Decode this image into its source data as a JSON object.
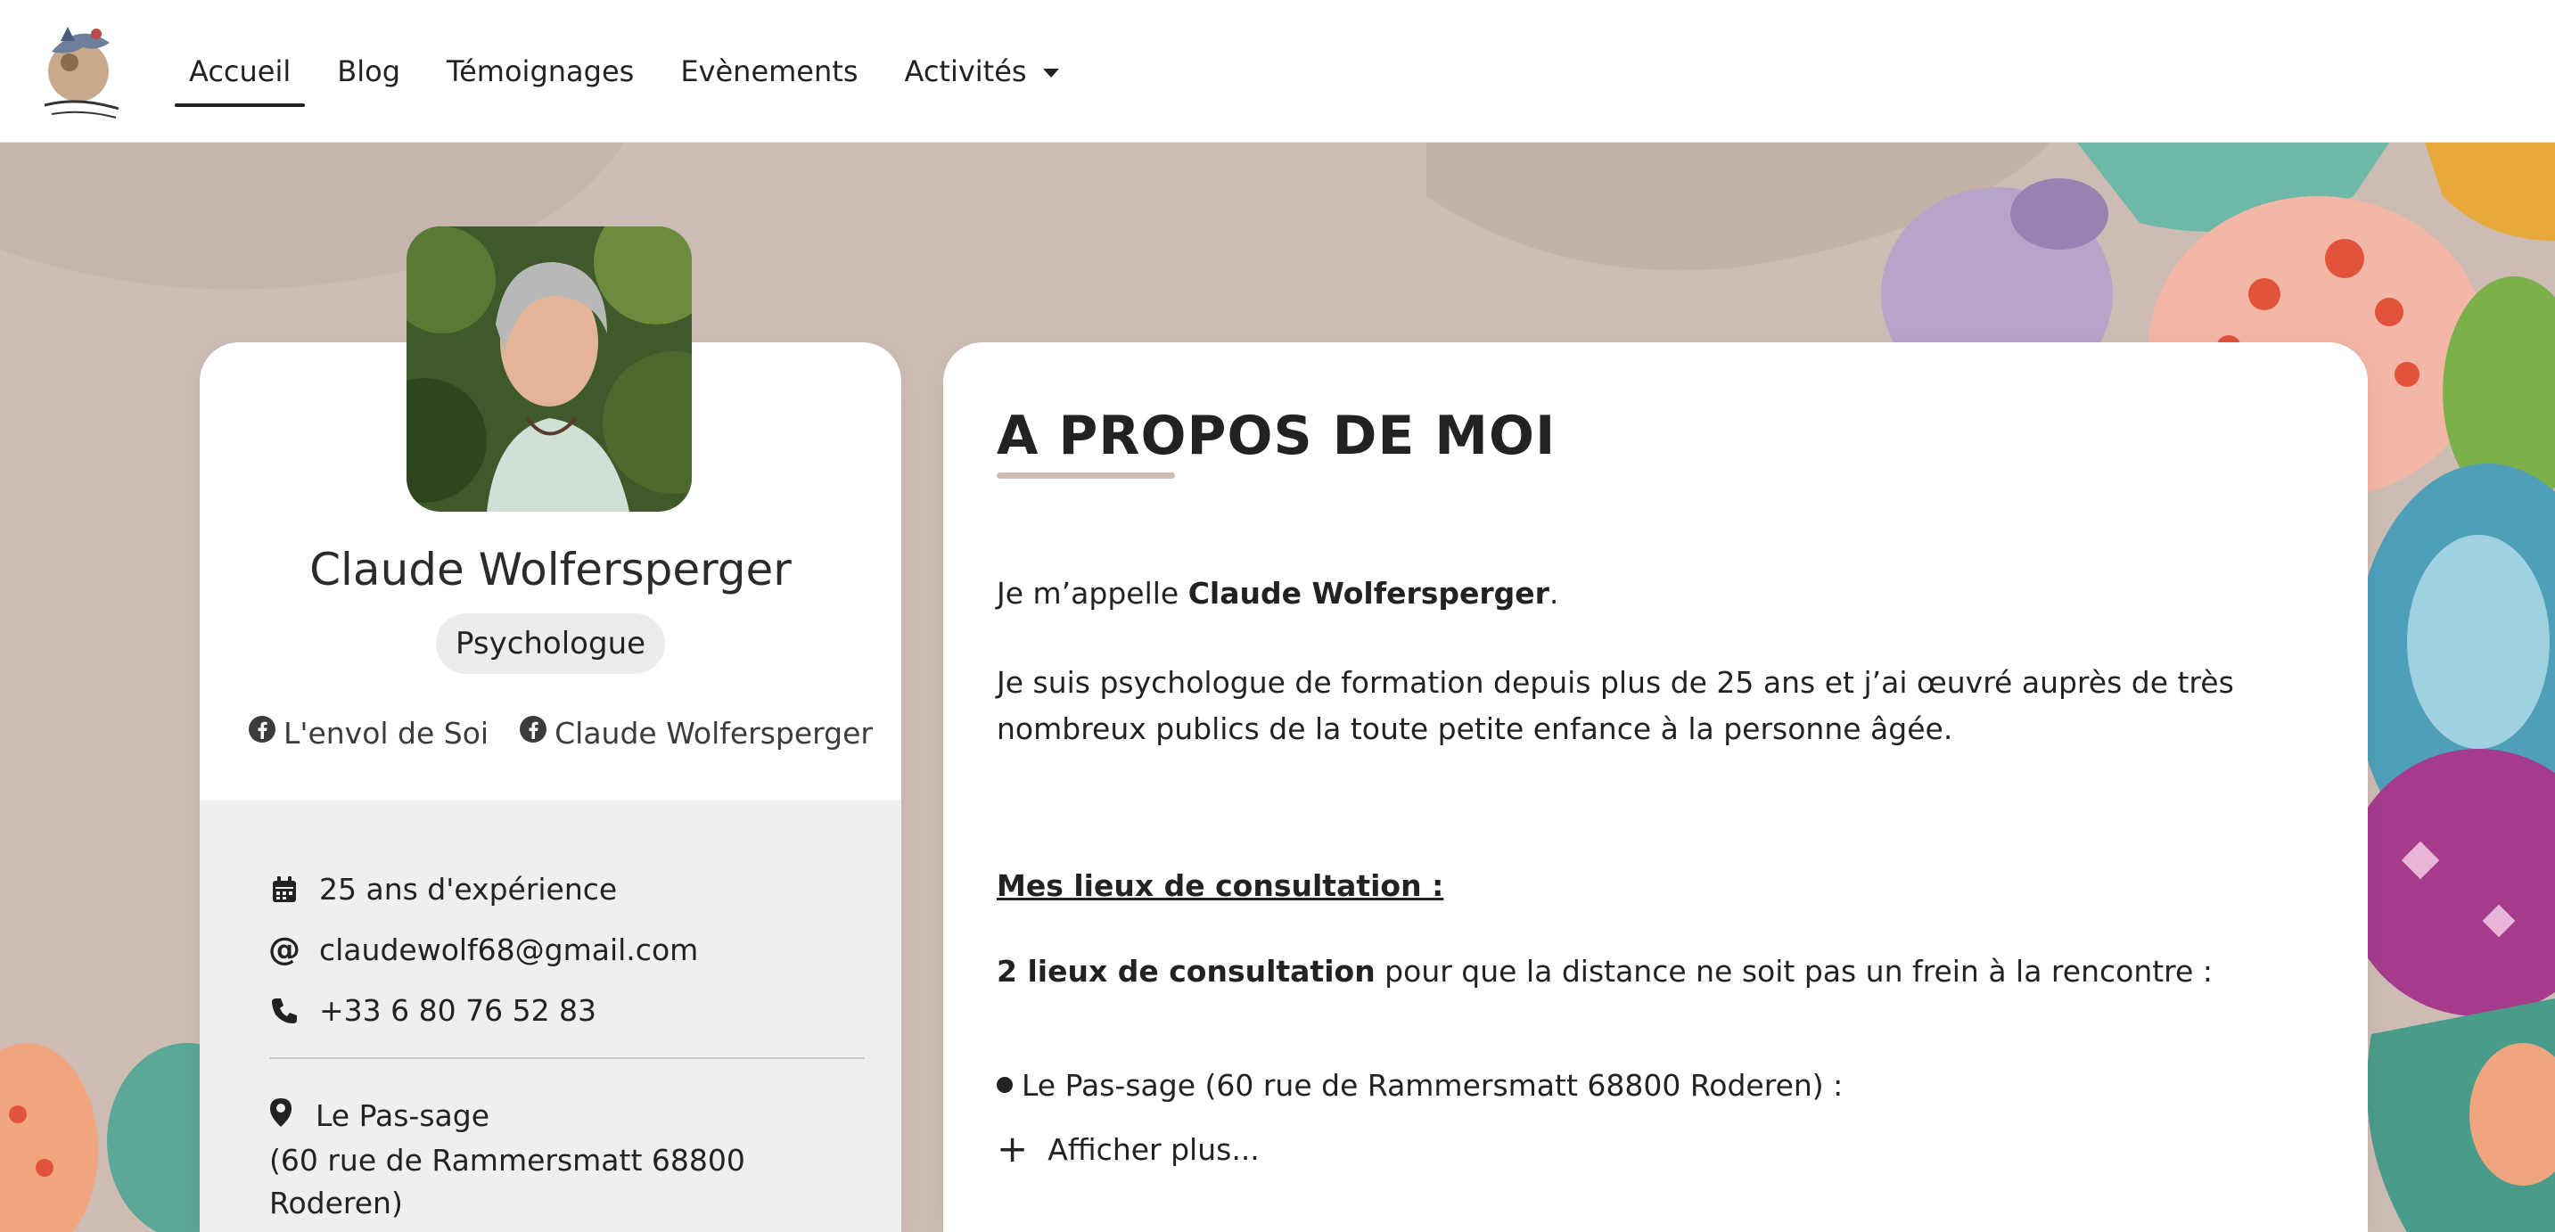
{
  "nav": {
    "logo_label": "L'envol de Soi",
    "items": [
      {
        "label": "Accueil",
        "active": true
      },
      {
        "label": "Blog"
      },
      {
        "label": "Témoignages"
      },
      {
        "label": "Evènements"
      },
      {
        "label": "Activités",
        "dropdown": true
      }
    ]
  },
  "profile": {
    "name": "Claude Wolfersperger",
    "role": "Psychologue",
    "socials": [
      {
        "icon": "facebook-icon",
        "label": "L'envol de Soi"
      },
      {
        "icon": "facebook-icon",
        "label": "Claude Wolfersperger"
      }
    ],
    "experience": "25 ans d'expérience",
    "email": "claudewolf68@gmail.com",
    "phone": "+33 6 80 76 52 83",
    "location_name": "Le Pas-sage",
    "location_addr": "(60 rue de Rammersmatt 68800 Roderen)"
  },
  "about": {
    "title": "A PROPOS DE MOI",
    "intro_prefix": "Je m’appelle ",
    "intro_name": "Claude Wolfersperger",
    "intro_suffix": ".",
    "bio": "Je suis psychologue de formation depuis plus de 25 ans et j’ai œuvré auprès de très nombreux publics de la toute petite enfance à la personne âgée.",
    "places_heading": "Mes lieux de consultation :",
    "places_bold": "2 lieux de consultation",
    "places_rest": " pour que la distance ne soit pas un frein à la rencontre :",
    "place_1": "Le Pas-sage (60 rue de Rammersmatt 68800 Roderen) :",
    "show_more": "Afficher plus..."
  },
  "colors": {
    "accent": "#cdbcb4",
    "text": "#222222",
    "info_bg": "#efefef"
  }
}
